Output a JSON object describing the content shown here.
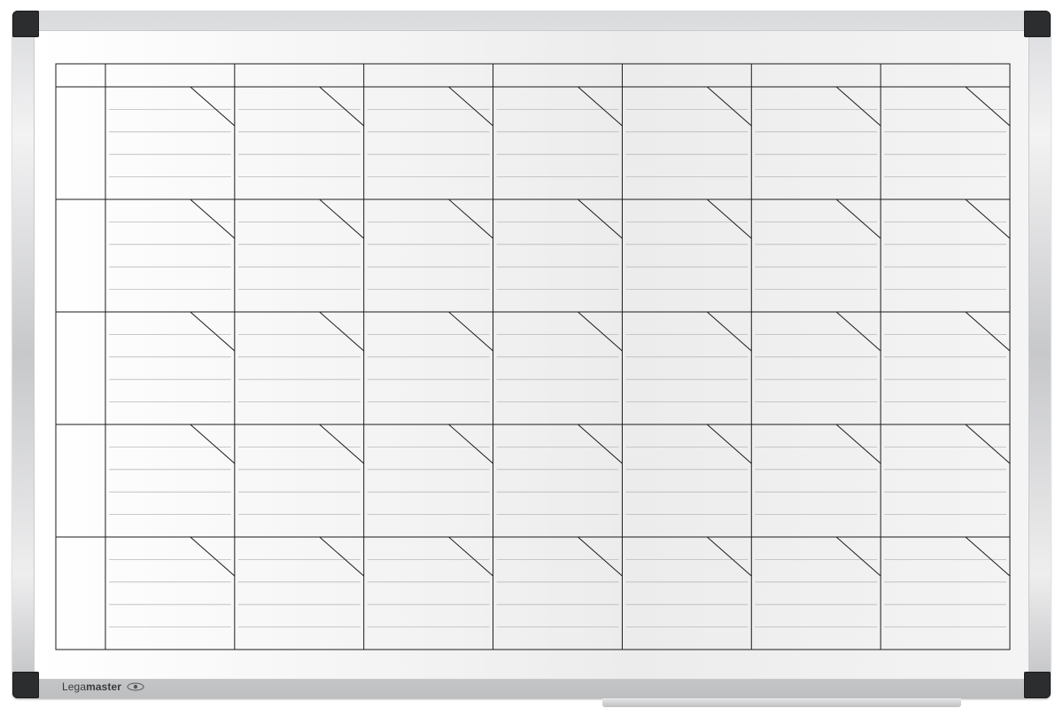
{
  "brand": {
    "name_prefix": "Lega",
    "name_suffix": "master",
    "logo_icon": "eye-logo-icon"
  },
  "planner": {
    "day_columns": 7,
    "week_rows": 5,
    "writing_lines_per_cell": 4,
    "has_header_row": true,
    "has_week_label_column": true,
    "day_number_corner": "top-right-diagonal"
  },
  "colors": {
    "grid_line": "#1a1a1a",
    "writing_line": "#b9b9b9",
    "board_surface": "#f2f2f2",
    "frame": "#c9cacc",
    "corner_caps": "#2c2d2f"
  }
}
